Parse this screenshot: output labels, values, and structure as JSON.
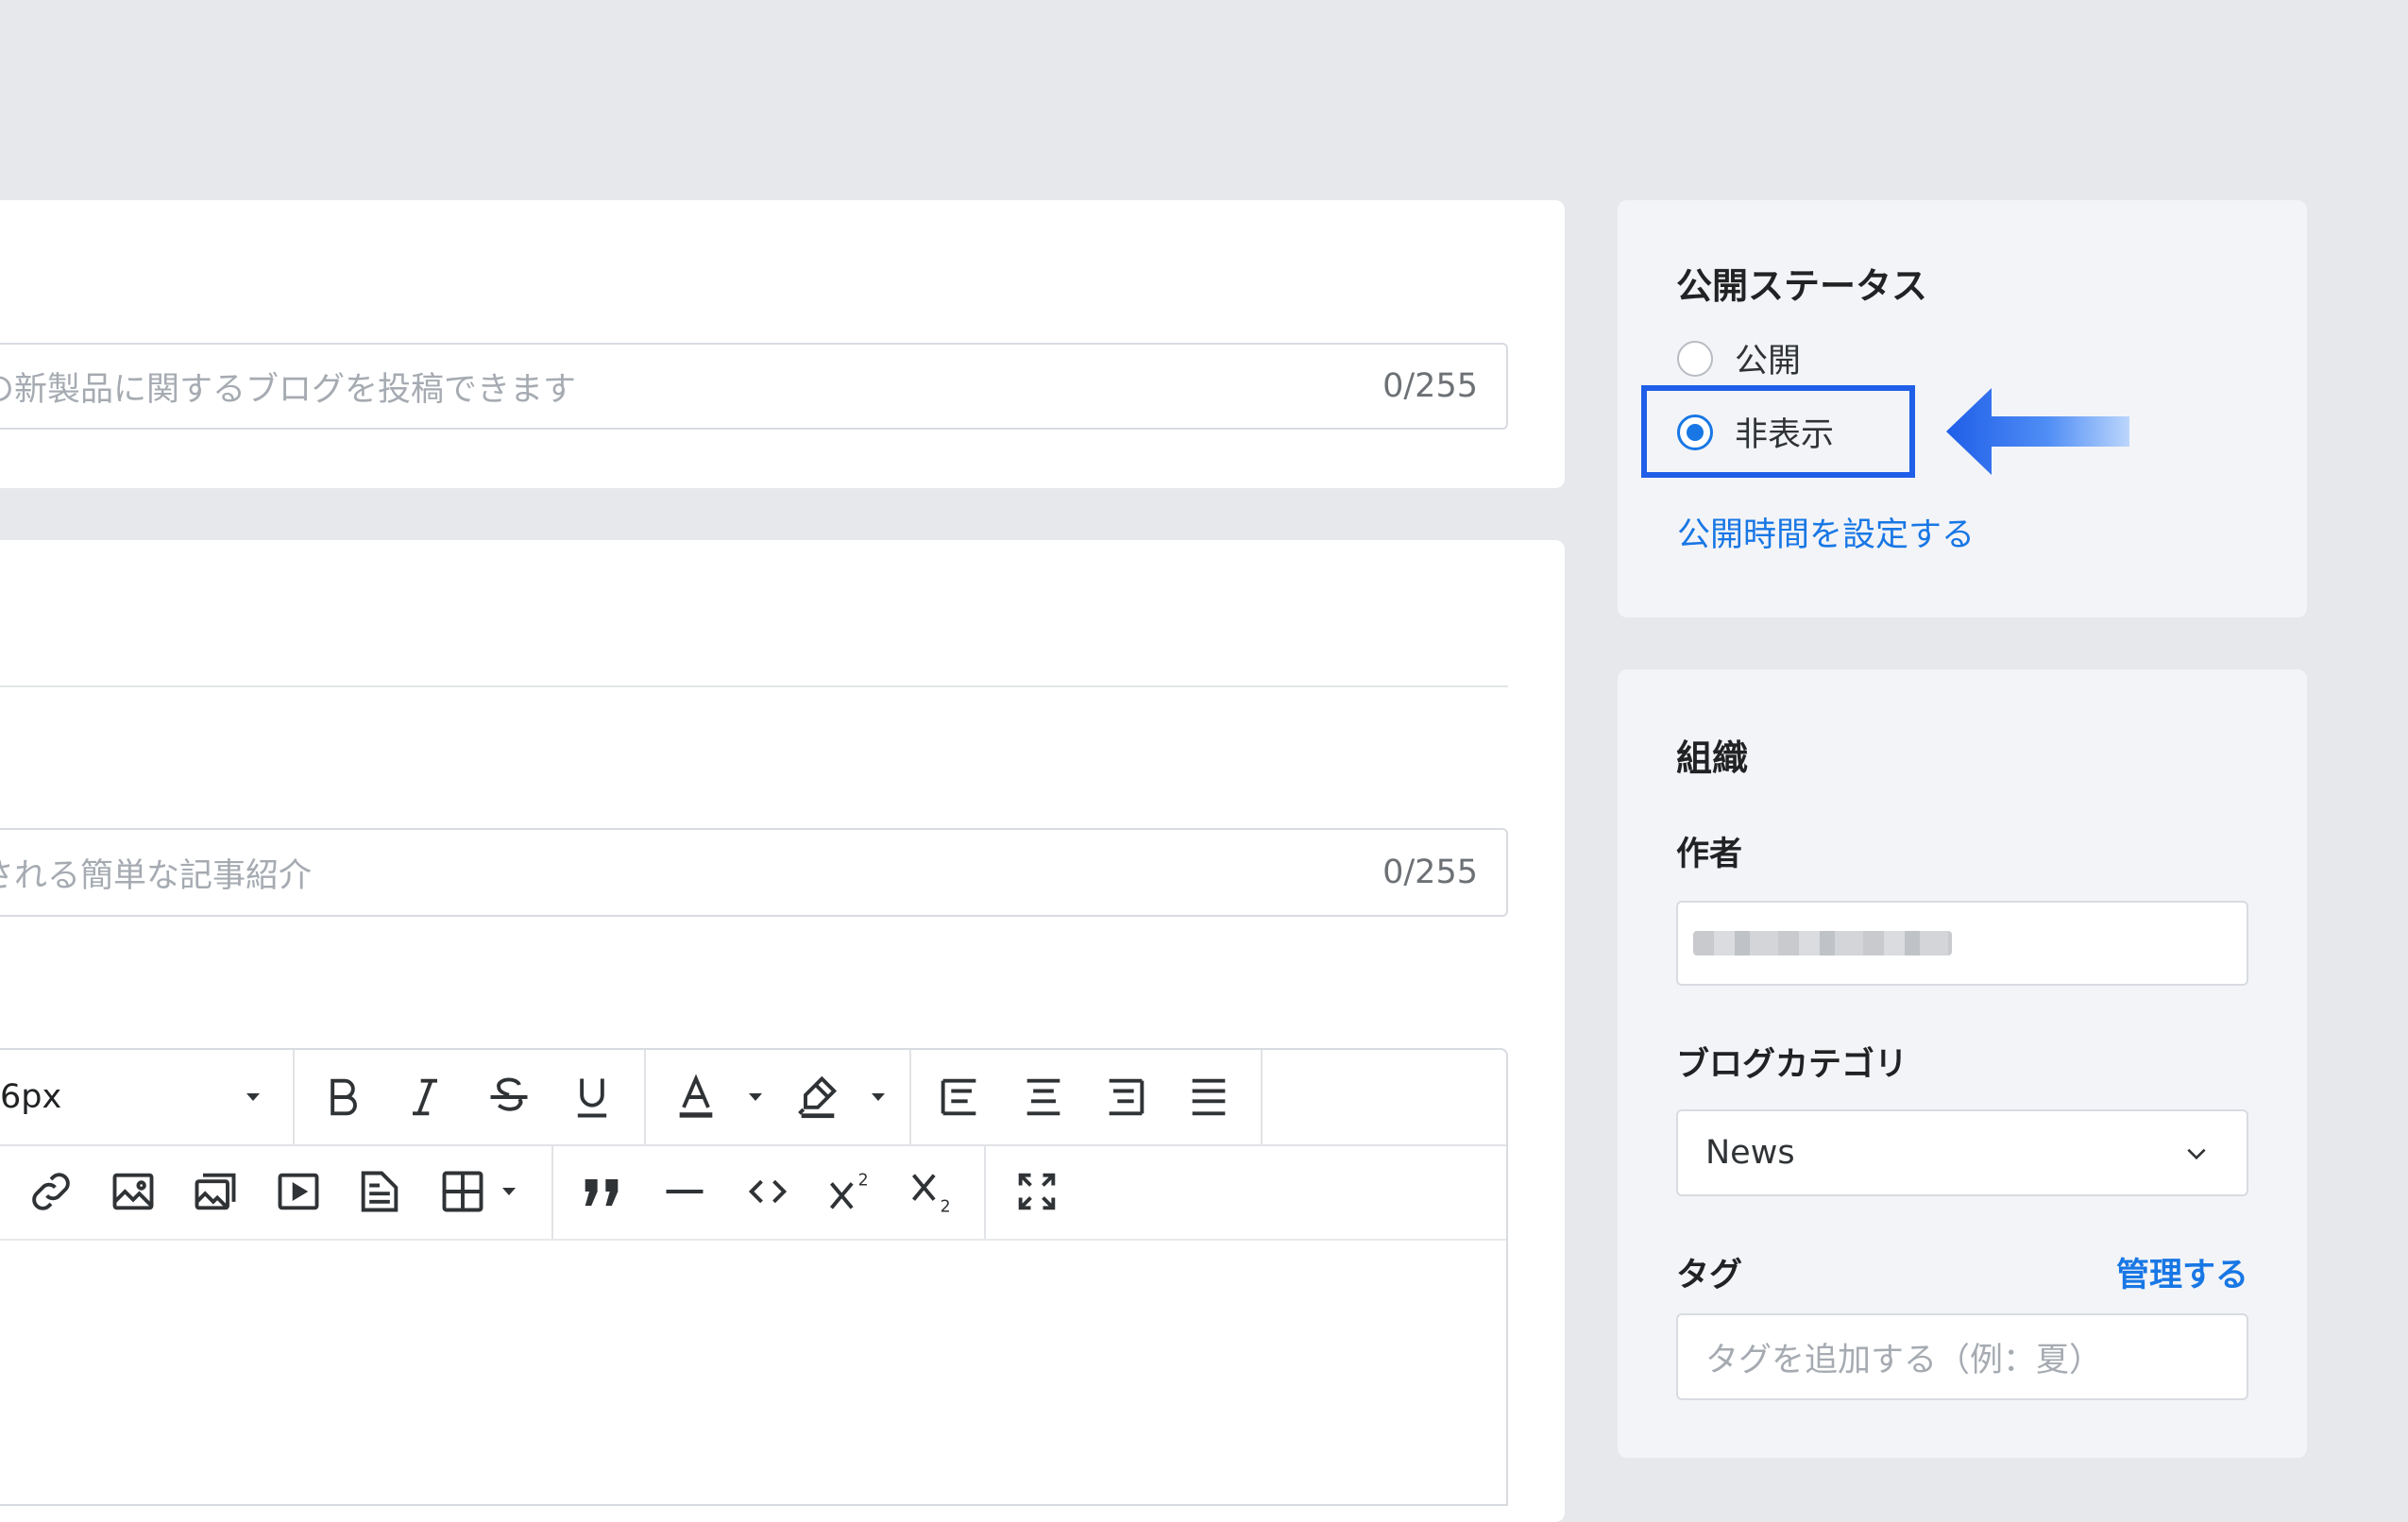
{
  "main": {
    "title_input": {
      "placeholder": "の新製品に関するブログを投稿できます",
      "counter": "0/255"
    },
    "excerpt_input": {
      "placeholder": "される簡単な記事紹介",
      "counter": "0/255"
    },
    "editor": {
      "font_size": "6px",
      "toolbar_row1": [
        "bold-icon",
        "italic-icon",
        "strikethrough-icon",
        "underline-icon",
        "font-color-icon",
        "highlight-icon",
        "align-left-icon",
        "align-center-icon",
        "align-right-icon",
        "justify-icon"
      ],
      "toolbar_row2": [
        "link-icon",
        "image-icon",
        "gallery-icon",
        "video-icon",
        "document-icon",
        "table-icon",
        "blockquote-icon",
        "horizontal-rule-icon",
        "code-icon",
        "superscript-icon",
        "subscript-icon",
        "fullscreen-icon"
      ]
    }
  },
  "sidebar": {
    "status": {
      "title": "公開ステータス",
      "options": [
        {
          "label": "公開",
          "selected": false
        },
        {
          "label": "非表示",
          "selected": true
        }
      ],
      "schedule_link": "公開時間を設定する"
    },
    "organization": {
      "title": "組織",
      "author_label": "作者",
      "category_label": "ブログカテゴリ",
      "category_value": "News",
      "tags_label": "タグ",
      "tags_manage": "管理する",
      "tags_placeholder": "タグを追加する（例：夏）"
    }
  },
  "colors": {
    "accent": "#1877e5",
    "highlight": "#1f5ee8",
    "background": "#e6e8ec"
  }
}
